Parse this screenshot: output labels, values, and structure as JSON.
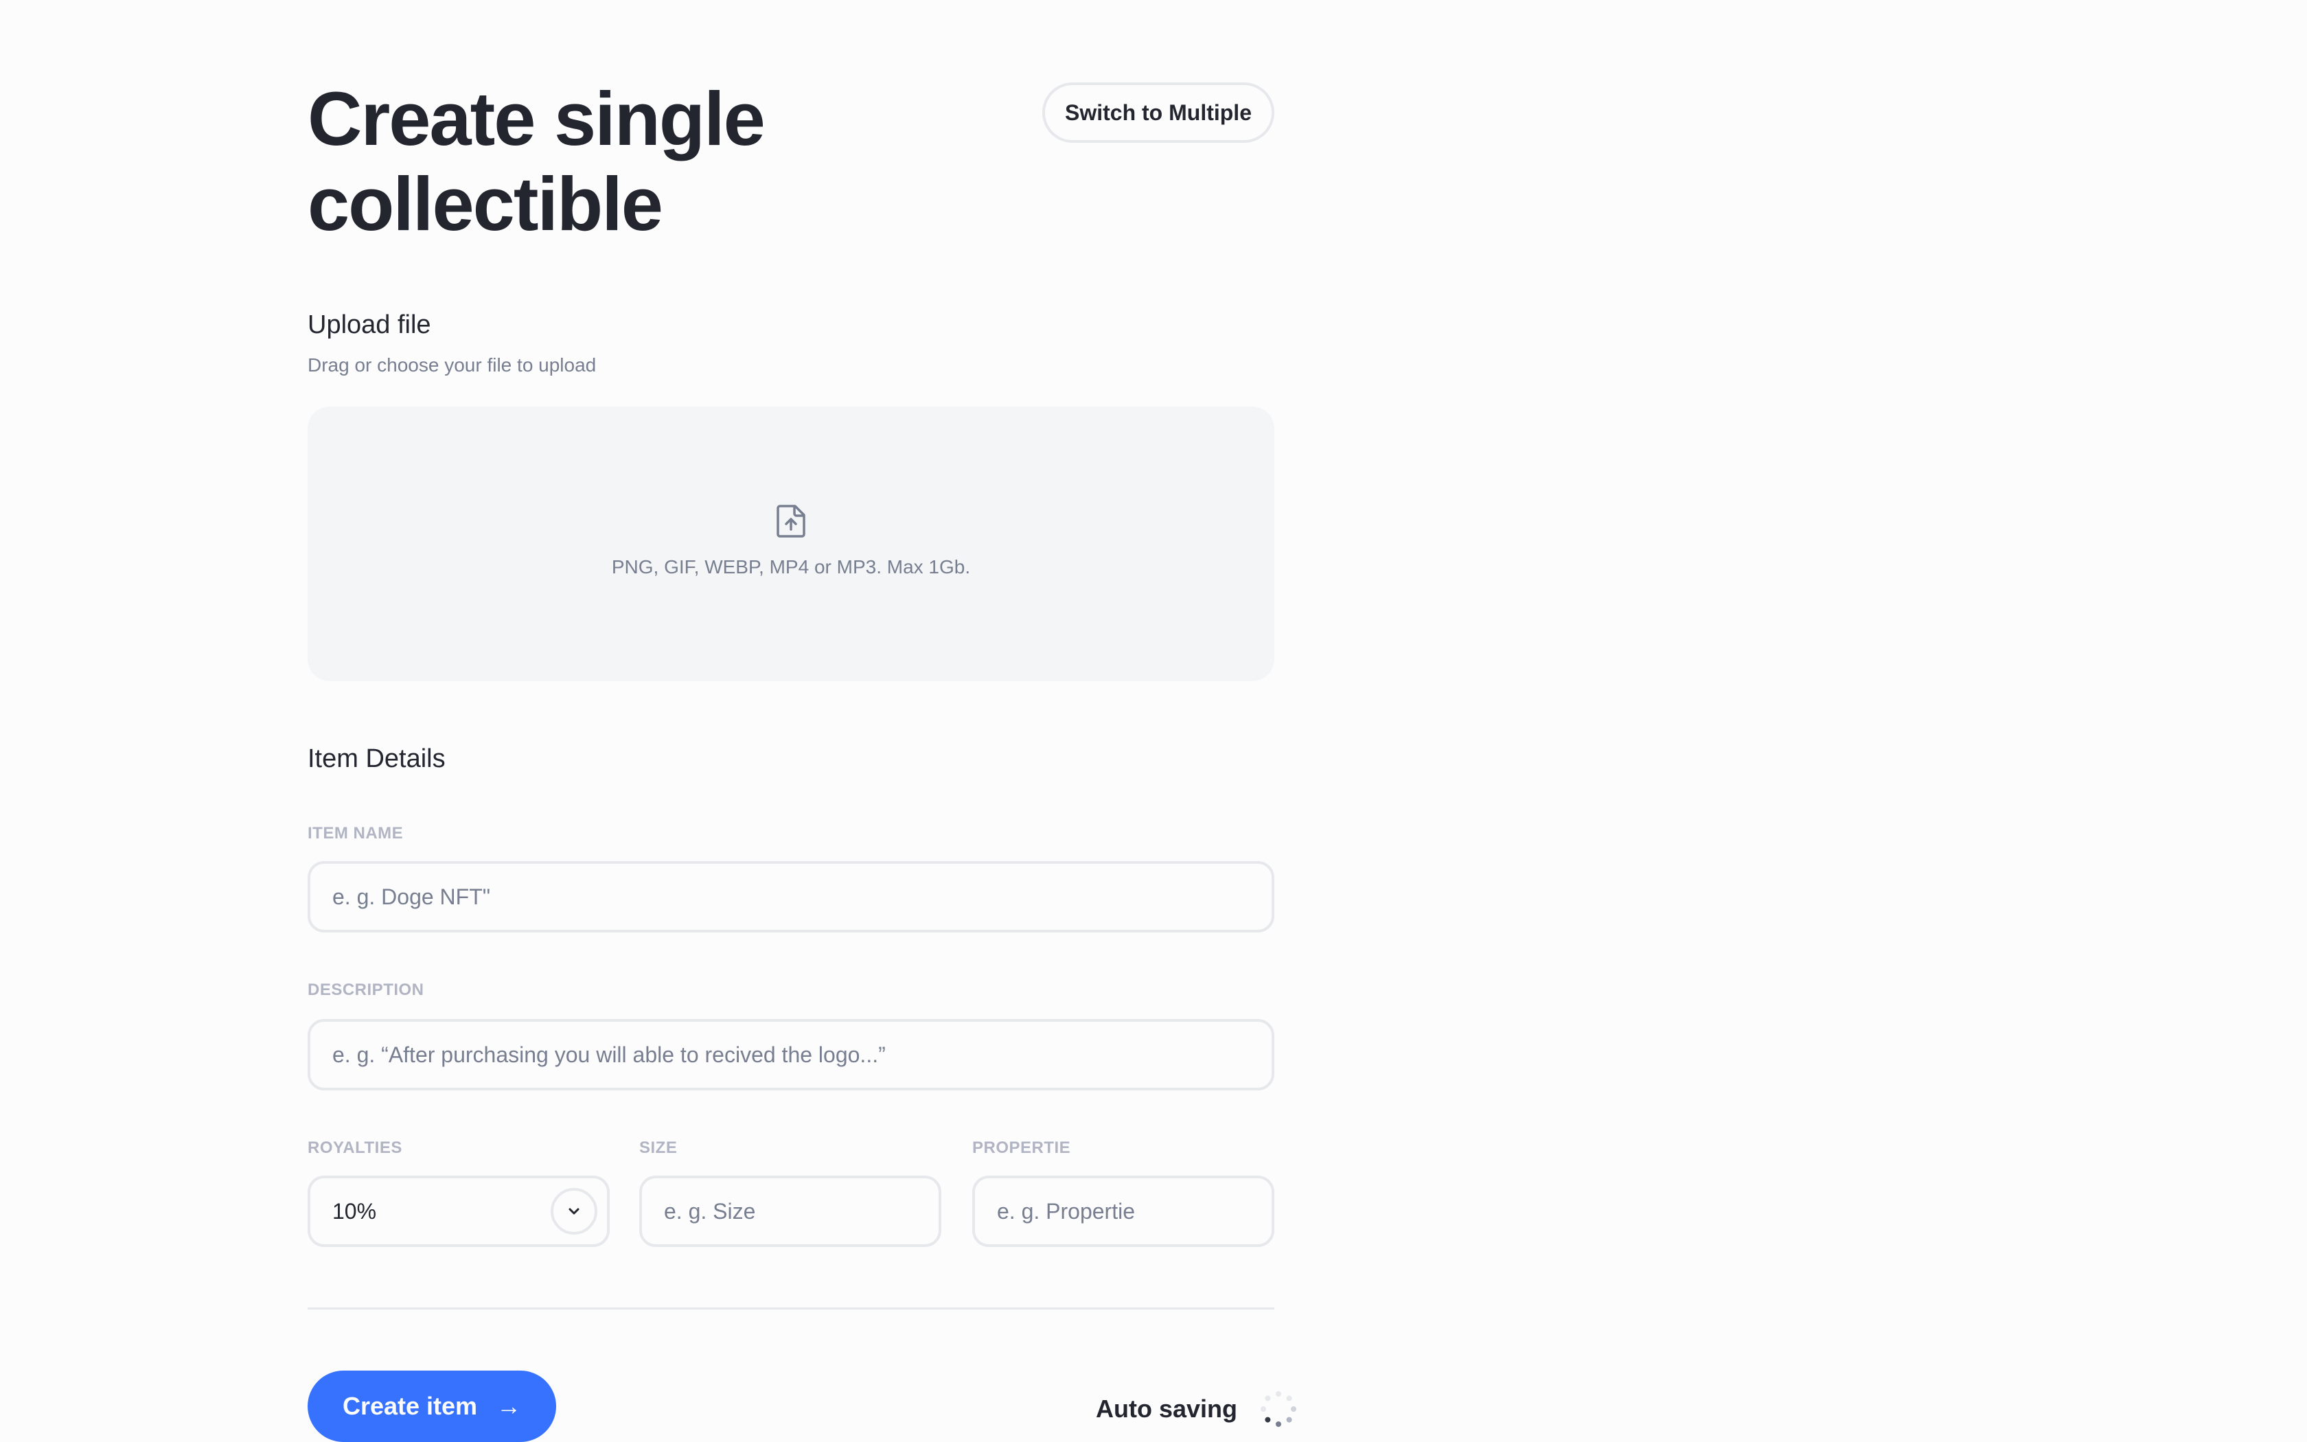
{
  "header": {
    "title": "Create single collectible",
    "switch_label": "Switch to Multiple"
  },
  "upload": {
    "title": "Upload file",
    "subtitle": "Drag or choose your file to upload",
    "formats": "PNG, GIF, WEBP, MP4 or MP3. Max 1Gb.",
    "icon": "file-upload-icon"
  },
  "details": {
    "title": "Item Details",
    "item_name": {
      "label": "ITEM NAME",
      "placeholder": "e. g. Doge NFT\""
    },
    "description": {
      "label": "DESCRIPTION",
      "placeholder": "e. g. “After purchasing you will able to recived the logo...”"
    },
    "royalties": {
      "label": "ROYALTIES",
      "value": "10%",
      "icon": "chevron-down-icon"
    },
    "size": {
      "label": "SIZE",
      "placeholder": "e. g. Size"
    },
    "propertie": {
      "label": "PROPERTIE",
      "placeholder": "e. g. Propertie"
    }
  },
  "footer": {
    "create_label": "Create item",
    "create_arrow": "→",
    "autosave_label": "Auto saving",
    "spinner_icon": "loading-spinner-icon"
  },
  "colors": {
    "accent": "#3772FF",
    "text": "#23262F",
    "muted": "#777E90",
    "border": "#E6E8EC",
    "dropzone_bg": "#F4F5F6"
  }
}
